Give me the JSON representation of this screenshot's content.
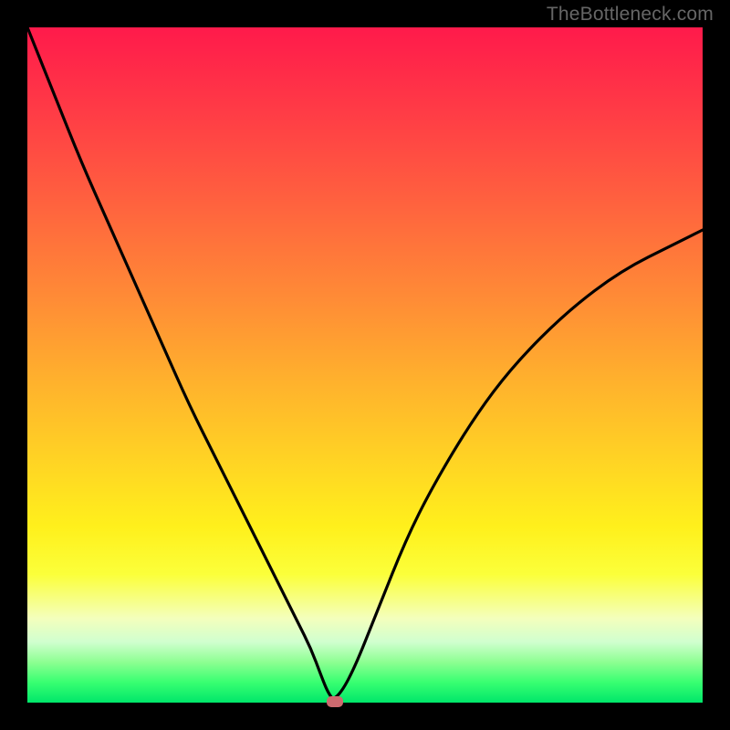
{
  "watermark": "TheBottleneck.com",
  "colors": {
    "frame_bg": "#000000",
    "gradient_top": "#ff1a4b",
    "gradient_bottom": "#00e66a",
    "curve": "#000000",
    "marker": "#cd6a6f",
    "watermark": "#666666"
  },
  "chart_data": {
    "type": "line",
    "title": "",
    "xlabel": "",
    "ylabel": "",
    "xlim": [
      0,
      100
    ],
    "ylim": [
      0,
      100
    ],
    "grid": false,
    "series": [
      {
        "name": "bottleneck-curve",
        "x": [
          0,
          4,
          8,
          12,
          16,
          20,
          24,
          28,
          32,
          36,
          40,
          42,
          43.5,
          44.5,
          45.5,
          48,
          52,
          56,
          60,
          66,
          72,
          80,
          88,
          96,
          100
        ],
        "values": [
          100,
          90,
          80,
          71,
          62,
          53,
          44,
          36,
          28,
          20,
          12,
          8,
          4,
          1.5,
          0.2,
          4,
          14,
          24,
          32,
          42,
          50,
          58,
          64,
          68,
          70
        ]
      }
    ],
    "marker": {
      "x_pct": 45.5,
      "y_from_bottom_pct": 0.2
    },
    "background": "rainbow-vertical-gradient"
  }
}
